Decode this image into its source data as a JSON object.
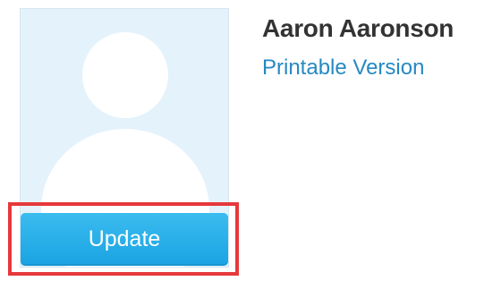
{
  "profile": {
    "name": "Aaron Aaronson",
    "printable_link": "Printable Version",
    "update_label": "Update",
    "avatar_icon": "default-user-silhouette"
  },
  "colors": {
    "avatar_background": "#e4f2fb",
    "button": "#1aa3e3",
    "link": "#2689c2",
    "highlight": "#e6383c"
  }
}
